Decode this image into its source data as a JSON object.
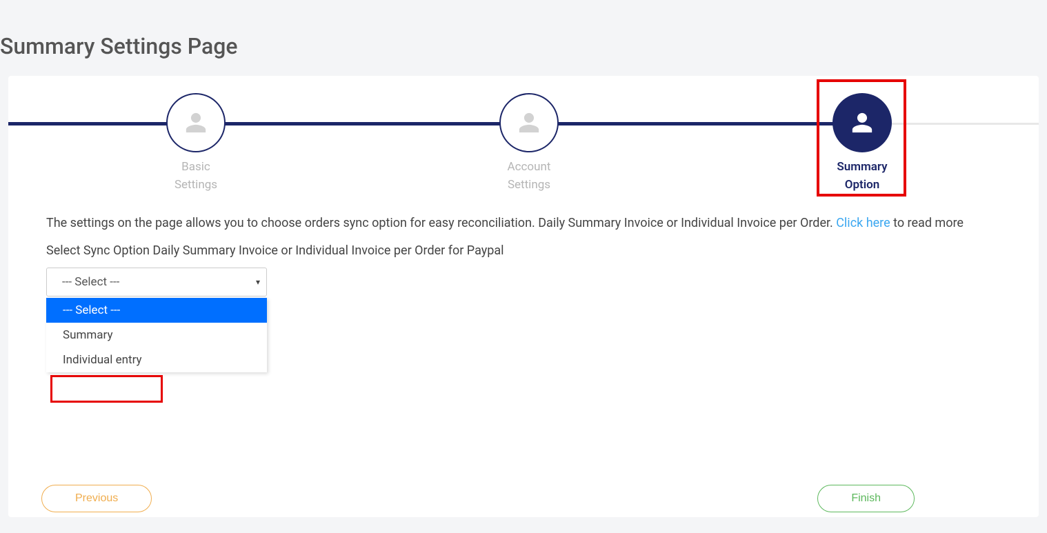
{
  "page_title": "Summary Settings Page",
  "stepper": {
    "steps": [
      {
        "label_line1": "Basic",
        "label_line2": "Settings",
        "active": false
      },
      {
        "label_line1": "Account",
        "label_line2": "Settings",
        "active": false
      },
      {
        "label_line1": "Summary",
        "label_line2": "Option",
        "active": true
      }
    ]
  },
  "description": {
    "text_before_link": "The settings on the page allows you to choose orders sync option for easy reconciliation. Daily Summary Invoice or Individual Invoice per Order. ",
    "link_text": "Click here",
    "text_after_link": " to read more"
  },
  "field": {
    "label": "Select Sync Option Daily Summary Invoice or Individual Invoice per Order for Paypal",
    "select_placeholder": "--- Select ---",
    "options": [
      {
        "label": "--- Select ---",
        "selected": true
      },
      {
        "label": "Summary",
        "selected": false
      },
      {
        "label": "Individual entry",
        "selected": false
      }
    ]
  },
  "buttons": {
    "previous": "Previous",
    "finish": "Finish"
  }
}
